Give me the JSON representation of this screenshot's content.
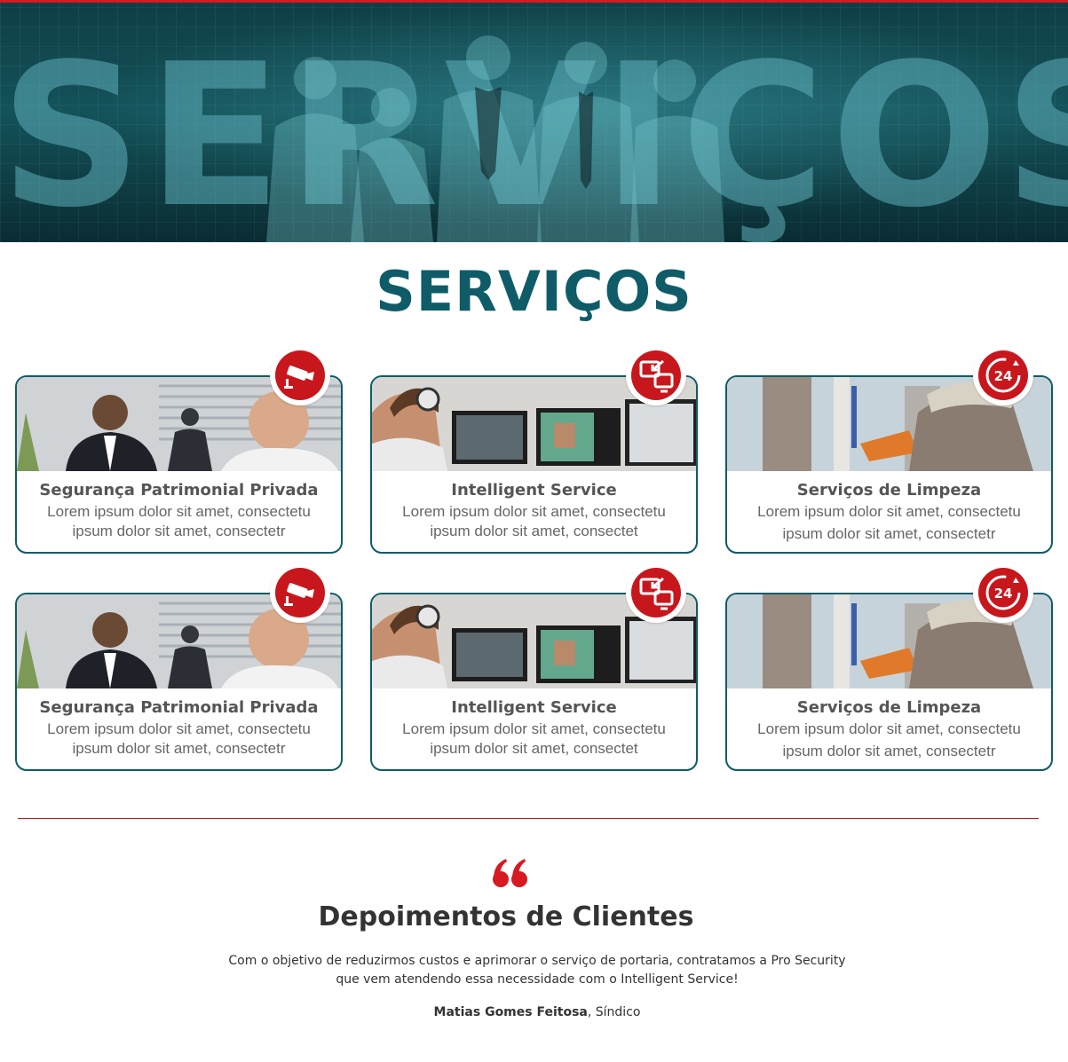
{
  "hero": {
    "background_word": "SERVIÇOS"
  },
  "section": {
    "title": "SERVIÇOS"
  },
  "services": [
    {
      "title": "Segurança Patrimonial Privada",
      "line1": "Lorem ipsum dolor sit amet, consectetu",
      "line2": "ipsum dolor sit amet, consectetr",
      "icon": "cctv-camera-icon"
    },
    {
      "title": "Intelligent Service",
      "line1": "Lorem ipsum dolor sit amet, consectetu",
      "line2": "ipsum dolor sit amet, consectet",
      "icon": "remote-monitor-icon"
    },
    {
      "title": "Serviços de Limpeza",
      "line1": "Lorem ipsum dolor sit amet, consectetu",
      "line2": "ipsum dolor sit amet, consectetr",
      "icon": "clock-24h-icon"
    },
    {
      "title": "Segurança Patrimonial Privada",
      "line1": "Lorem ipsum dolor sit amet, consectetu",
      "line2": "ipsum dolor sit amet, consectetr",
      "icon": "cctv-camera-icon"
    },
    {
      "title": "Intelligent Service",
      "line1": "Lorem ipsum dolor sit amet, consectetu",
      "line2": "ipsum dolor sit amet, consectet",
      "icon": "remote-monitor-icon"
    },
    {
      "title": "Serviços de Limpeza",
      "line1": "Lorem ipsum dolor sit amet, consectetu",
      "line2": "ipsum dolor sit amet, consectetr",
      "icon": "clock-24h-icon"
    }
  ],
  "badge_24_label": "24",
  "testimonials": {
    "title": "Depoimentos de Clientes",
    "text": "Com o objetivo de reduzirmos custos e aprimorar o serviço de portaria, contratamos a Pro Security que vem atendendo essa necessidade com o Intelligent Service!",
    "author_name": "Matias Gomes Feitosa",
    "author_role": ", Síndico"
  },
  "colors": {
    "brand_teal": "#0f5c68",
    "accent_red": "#c8161d",
    "text_dark": "#333333",
    "text_gray": "#666666"
  }
}
